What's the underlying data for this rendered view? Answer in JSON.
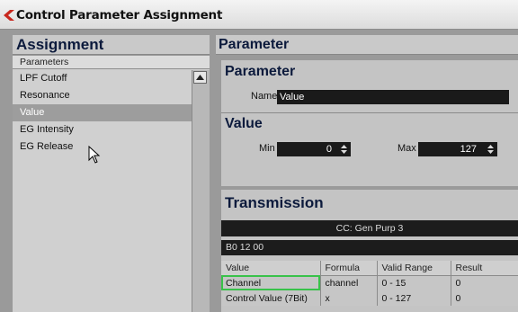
{
  "window": {
    "title": "Control Parameter Assignment"
  },
  "assignment": {
    "heading": "Assignment",
    "list_header": "Parameters",
    "items": [
      "LPF Cutoff",
      "Resonance",
      "Value",
      "EG Intensity",
      "EG Release"
    ],
    "selected": "Value"
  },
  "parameter_panel": {
    "heading": "Parameter",
    "parameter_section": {
      "title": "Parameter",
      "name_label": "Name",
      "name_value": "Value"
    },
    "value_section": {
      "title": "Value",
      "min_label": "Min",
      "min_value": "0",
      "max_label": "Max",
      "max_value": "127"
    },
    "transmission_section": {
      "title": "Transmission",
      "message_type": "CC: Gen Purp 3",
      "hex_string": "B0 12 00",
      "columns": [
        "Value",
        "Formula",
        "Valid Range",
        "Result"
      ],
      "rows": [
        [
          "Channel",
          "channel",
          "0 - 15",
          "0"
        ],
        [
          "Control Value (7Bit)",
          "x",
          "0 - 127",
          "0"
        ]
      ]
    }
  },
  "colors": {
    "accent_red": "#c8281e",
    "heading_navy": "#0c1a3c",
    "selection_green": "#39c24a"
  },
  "icons": {
    "title_back": "red-back-arrow-icon",
    "scroll_up": "triangle-up-icon",
    "cursor": "mouse-pointer-icon"
  }
}
